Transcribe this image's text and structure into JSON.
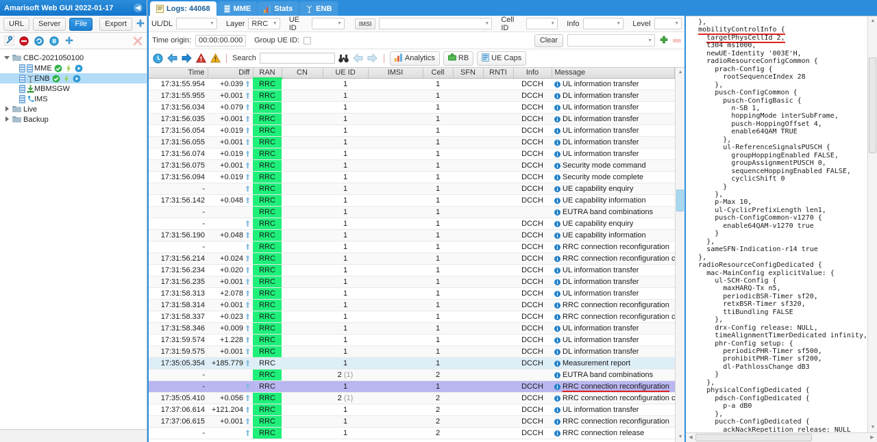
{
  "left": {
    "title": "Amarisoft Web GUI 2022-01-17",
    "collapse_icon": "chevron-left-icon",
    "source_buttons": [
      {
        "label": "URL",
        "active": false
      },
      {
        "label": "Server",
        "active": false
      },
      {
        "label": "File",
        "active": true
      }
    ],
    "export_label": "Export",
    "export_plus_icon": "blue-plus-icon",
    "tool_icons": [
      "wrench-icon",
      "stop-icon",
      "refresh-icon",
      "pause-icon",
      "blue-plus-icon"
    ],
    "delete_icon": "red-x-icon",
    "tree": [
      {
        "label": "CBC-2021050100",
        "level": 0,
        "type": "folder",
        "expanded": true,
        "selected": false,
        "badges": []
      },
      {
        "label": "MME",
        "level": 1,
        "type": "server",
        "selected": false,
        "badges": [
          "green-check-icon",
          "yellow-bolt-icon",
          "blue-play-icon"
        ]
      },
      {
        "label": "ENB",
        "level": 1,
        "type": "antenna",
        "selected": true,
        "badges": [
          "green-check-icon",
          "yellow-bolt-icon",
          "blue-play-icon"
        ]
      },
      {
        "label": "MBMSGW",
        "level": 1,
        "type": "download",
        "selected": false,
        "badges": []
      },
      {
        "label": "IMS",
        "level": 1,
        "type": "phone",
        "selected": false,
        "badges": []
      },
      {
        "label": "Live",
        "level": 0,
        "type": "folder",
        "expanded": false,
        "selected": false,
        "badges": []
      },
      {
        "label": "Backup",
        "level": 0,
        "type": "folder",
        "expanded": false,
        "selected": false,
        "badges": []
      }
    ]
  },
  "tabs": [
    {
      "label": "Logs: 44068",
      "icon": "document-icon",
      "active": true
    },
    {
      "label": "MME",
      "icon": "server-icon",
      "active": false
    },
    {
      "label": "Stats",
      "icon": "bar-chart-icon",
      "active": false
    },
    {
      "label": "ENB",
      "icon": "antenna-icon",
      "active": false
    }
  ],
  "filters": {
    "uldl": {
      "label": "UL/DL",
      "value": ""
    },
    "layer": {
      "label": "Layer",
      "value": "RRC"
    },
    "ueid": {
      "label": "UE ID",
      "value": ""
    },
    "imsi": {
      "label": "IMSI",
      "value": ""
    },
    "cellid": {
      "label": "Cell ID",
      "value": ""
    },
    "info": {
      "label": "Info",
      "value": ""
    },
    "level": {
      "label": "Level",
      "value": ""
    }
  },
  "origin": {
    "time_origin_label": "Time origin:",
    "time_origin_value": "00:00:00.000",
    "group_ue_id_label": "Group UE ID:",
    "group_ue_id_checked": false,
    "clear_label": "Clear",
    "preset_value": "",
    "add_icon": "green-plus-icon",
    "remove_icon": "red-minus-icon"
  },
  "actions": {
    "icons": [
      "clock-icon",
      "arrow-left-blue-icon",
      "arrow-right-blue-icon",
      "error-triangle-icon",
      "warning-triangle-icon"
    ],
    "search_label": "Search",
    "search_value": "",
    "search_placeholder": "",
    "binoculars_icon": "binoculars-icon",
    "prev_icon": "arrow-left-grey-icon",
    "next_icon": "arrow-right-grey-icon",
    "buttons": [
      {
        "label": "Analytics",
        "icon": "bar-chart-icon"
      },
      {
        "label": "RB",
        "icon": "green-box-icon"
      },
      {
        "label": "UE Caps",
        "icon": "blue-card-icon"
      }
    ]
  },
  "table": {
    "columns": [
      "Time",
      "Diff",
      "RAN",
      "CN",
      "UE ID",
      "IMSI",
      "Cell",
      "SFN",
      "RNTI",
      "Info",
      "Message"
    ],
    "rows": [
      {
        "time": "17:31:55.954",
        "diff": "+0.039",
        "arrow": true,
        "ran": "RRC",
        "cn": "",
        "ueid": "1",
        "imsi": "",
        "cell": "1",
        "sfn": "",
        "rnti": "",
        "info": "DCCH",
        "message": "UL information transfer",
        "state": ""
      },
      {
        "time": "17:31:55.955",
        "diff": "+0.001",
        "arrow": true,
        "ran": "RRC",
        "cn": "",
        "ueid": "1",
        "imsi": "",
        "cell": "1",
        "sfn": "",
        "rnti": "",
        "info": "DCCH",
        "message": "DL information transfer",
        "state": "alt"
      },
      {
        "time": "17:31:56.034",
        "diff": "+0.079",
        "arrow": true,
        "ran": "RRC",
        "cn": "",
        "ueid": "1",
        "imsi": "",
        "cell": "1",
        "sfn": "",
        "rnti": "",
        "info": "DCCH",
        "message": "UL information transfer",
        "state": ""
      },
      {
        "time": "17:31:56.035",
        "diff": "+0.001",
        "arrow": true,
        "ran": "RRC",
        "cn": "",
        "ueid": "1",
        "imsi": "",
        "cell": "1",
        "sfn": "",
        "rnti": "",
        "info": "DCCH",
        "message": "DL information transfer",
        "state": "alt"
      },
      {
        "time": "17:31:56.054",
        "diff": "+0.019",
        "arrow": true,
        "ran": "RRC",
        "cn": "",
        "ueid": "1",
        "imsi": "",
        "cell": "1",
        "sfn": "",
        "rnti": "",
        "info": "DCCH",
        "message": "UL information transfer",
        "state": ""
      },
      {
        "time": "17:31:56.055",
        "diff": "+0.001",
        "arrow": true,
        "ran": "RRC",
        "cn": "",
        "ueid": "1",
        "imsi": "",
        "cell": "1",
        "sfn": "",
        "rnti": "",
        "info": "DCCH",
        "message": "DL information transfer",
        "state": "alt"
      },
      {
        "time": "17:31:56.074",
        "diff": "+0.019",
        "arrow": true,
        "ran": "RRC",
        "cn": "",
        "ueid": "1",
        "imsi": "",
        "cell": "1",
        "sfn": "",
        "rnti": "",
        "info": "DCCH",
        "message": "UL information transfer",
        "state": ""
      },
      {
        "time": "17:31:56.075",
        "diff": "+0.001",
        "arrow": true,
        "ran": "RRC",
        "cn": "",
        "ueid": "1",
        "imsi": "",
        "cell": "1",
        "sfn": "",
        "rnti": "",
        "info": "DCCH",
        "message": "Security mode command",
        "state": "alt"
      },
      {
        "time": "17:31:56.094",
        "diff": "+0.019",
        "arrow": true,
        "ran": "RRC",
        "cn": "",
        "ueid": "1",
        "imsi": "",
        "cell": "1",
        "sfn": "",
        "rnti": "",
        "info": "DCCH",
        "message": "Security mode complete",
        "state": ""
      },
      {
        "time": "-",
        "diff": "",
        "arrow": true,
        "ran": "RRC",
        "cn": "",
        "ueid": "1",
        "imsi": "",
        "cell": "1",
        "sfn": "",
        "rnti": "",
        "info": "DCCH",
        "message": "UE capability enquiry",
        "state": "alt"
      },
      {
        "time": "17:31:56.142",
        "diff": "+0.048",
        "arrow": true,
        "ran": "RRC",
        "cn": "",
        "ueid": "1",
        "imsi": "",
        "cell": "1",
        "sfn": "",
        "rnti": "",
        "info": "DCCH",
        "message": "UE capability information",
        "state": ""
      },
      {
        "time": "-",
        "diff": "",
        "arrow": false,
        "ran": "RRC",
        "cn": "",
        "ueid": "1",
        "imsi": "",
        "cell": "1",
        "sfn": "",
        "rnti": "",
        "info": "",
        "message": "EUTRA band combinations",
        "state": "alt"
      },
      {
        "time": "-",
        "diff": "",
        "arrow": true,
        "ran": "RRC",
        "cn": "",
        "ueid": "1",
        "imsi": "",
        "cell": "1",
        "sfn": "",
        "rnti": "",
        "info": "DCCH",
        "message": "UE capability enquiry",
        "state": ""
      },
      {
        "time": "17:31:56.190",
        "diff": "+0.048",
        "arrow": true,
        "ran": "RRC",
        "cn": "",
        "ueid": "1",
        "imsi": "",
        "cell": "1",
        "sfn": "",
        "rnti": "",
        "info": "DCCH",
        "message": "UE capability information",
        "state": "alt"
      },
      {
        "time": "-",
        "diff": "",
        "arrow": true,
        "ran": "RRC",
        "cn": "",
        "ueid": "1",
        "imsi": "",
        "cell": "1",
        "sfn": "",
        "rnti": "",
        "info": "DCCH",
        "message": "RRC connection reconfiguration",
        "state": ""
      },
      {
        "time": "17:31:56.214",
        "diff": "+0.024",
        "arrow": true,
        "ran": "RRC",
        "cn": "",
        "ueid": "1",
        "imsi": "",
        "cell": "1",
        "sfn": "",
        "rnti": "",
        "info": "DCCH",
        "message": "RRC connection reconfiguration complete",
        "state": "alt"
      },
      {
        "time": "17:31:56.234",
        "diff": "+0.020",
        "arrow": true,
        "ran": "RRC",
        "cn": "",
        "ueid": "1",
        "imsi": "",
        "cell": "1",
        "sfn": "",
        "rnti": "",
        "info": "DCCH",
        "message": "UL information transfer",
        "state": ""
      },
      {
        "time": "17:31:56.235",
        "diff": "+0.001",
        "arrow": true,
        "ran": "RRC",
        "cn": "",
        "ueid": "1",
        "imsi": "",
        "cell": "1",
        "sfn": "",
        "rnti": "",
        "info": "DCCH",
        "message": "DL information transfer",
        "state": "alt"
      },
      {
        "time": "17:31:58.313",
        "diff": "+2.078",
        "arrow": true,
        "ran": "RRC",
        "cn": "",
        "ueid": "1",
        "imsi": "",
        "cell": "1",
        "sfn": "",
        "rnti": "",
        "info": "DCCH",
        "message": "UL information transfer",
        "state": ""
      },
      {
        "time": "17:31:58.314",
        "diff": "+0.001",
        "arrow": true,
        "ran": "RRC",
        "cn": "",
        "ueid": "1",
        "imsi": "",
        "cell": "1",
        "sfn": "",
        "rnti": "",
        "info": "DCCH",
        "message": "RRC connection reconfiguration",
        "state": "alt"
      },
      {
        "time": "17:31:58.337",
        "diff": "+0.023",
        "arrow": true,
        "ran": "RRC",
        "cn": "",
        "ueid": "1",
        "imsi": "",
        "cell": "1",
        "sfn": "",
        "rnti": "",
        "info": "DCCH",
        "message": "RRC connection reconfiguration complete",
        "state": ""
      },
      {
        "time": "17:31:58.346",
        "diff": "+0.009",
        "arrow": true,
        "ran": "RRC",
        "cn": "",
        "ueid": "1",
        "imsi": "",
        "cell": "1",
        "sfn": "",
        "rnti": "",
        "info": "DCCH",
        "message": "UL information transfer",
        "state": "alt"
      },
      {
        "time": "17:31:59.574",
        "diff": "+1.228",
        "arrow": true,
        "ran": "RRC",
        "cn": "",
        "ueid": "1",
        "imsi": "",
        "cell": "1",
        "sfn": "",
        "rnti": "",
        "info": "DCCH",
        "message": "UL information transfer",
        "state": ""
      },
      {
        "time": "17:31:59.575",
        "diff": "+0.001",
        "arrow": true,
        "ran": "RRC",
        "cn": "",
        "ueid": "1",
        "imsi": "",
        "cell": "1",
        "sfn": "",
        "rnti": "",
        "info": "DCCH",
        "message": "DL information transfer",
        "state": "alt"
      },
      {
        "time": "17:35:05.354",
        "diff": "+185.779",
        "arrow": true,
        "ran": "RRC",
        "cn": "",
        "ueid": "1",
        "imsi": "",
        "cell": "1",
        "sfn": "",
        "rnti": "",
        "info": "DCCH",
        "message": "Measurement report",
        "state": "sel-blue"
      },
      {
        "time": "-",
        "diff": "",
        "arrow": false,
        "ran": "RRC",
        "cn": "",
        "ueid": "2",
        "ueid_sub": "(1)",
        "imsi": "",
        "cell": "2",
        "sfn": "",
        "rnti": "",
        "info": "",
        "message": "EUTRA band combinations",
        "state": "alt"
      },
      {
        "time": "-",
        "diff": "",
        "arrow": true,
        "ran": "RRC",
        "cn": "",
        "ueid": "1",
        "imsi": "",
        "cell": "1",
        "sfn": "",
        "rnti": "",
        "info": "DCCH",
        "message": "RRC connection reconfiguration",
        "state": "sel-purple",
        "underlined": true
      },
      {
        "time": "17:35:05.410",
        "diff": "+0.056",
        "arrow": true,
        "ran": "RRC",
        "cn": "",
        "ueid": "2",
        "ueid_sub": "(1)",
        "imsi": "",
        "cell": "2",
        "sfn": "",
        "rnti": "",
        "info": "DCCH",
        "message": "RRC connection reconfiguration complete",
        "state": "alt"
      },
      {
        "time": "17:37:06.614",
        "diff": "+121.204",
        "arrow": true,
        "ran": "RRC",
        "cn": "",
        "ueid": "1",
        "imsi": "",
        "cell": "2",
        "sfn": "",
        "rnti": "",
        "info": "DCCH",
        "message": "UL information transfer",
        "state": ""
      },
      {
        "time": "17:37:06.615",
        "diff": "+0.001",
        "arrow": true,
        "ran": "RRC",
        "cn": "",
        "ueid": "1",
        "imsi": "",
        "cell": "2",
        "sfn": "",
        "rnti": "",
        "info": "DCCH",
        "message": "RRC connection reconfiguration",
        "state": "alt"
      },
      {
        "time": "-",
        "diff": "",
        "arrow": true,
        "ran": "RRC",
        "cn": "",
        "ueid": "1",
        "imsi": "",
        "cell": "2",
        "sfn": "",
        "rnti": "",
        "info": "DCCH",
        "message": "RRC connection release",
        "state": ""
      }
    ]
  },
  "detail": {
    "lines": [
      "  },",
      "  mobilityControlInfo {",
      "    targetPhysCellId 2,",
      "    t304 ms1000,",
      "    newUE-Identity '003E'H,",
      "    radioResourceConfigCommon {",
      "      prach-Config {",
      "        rootSequenceIndex 28",
      "      },",
      "      pusch-ConfigCommon {",
      "        pusch-ConfigBasic {",
      "          n-SB 1,",
      "          hoppingMode interSubFrame,",
      "          pusch-HoppingOffset 4,",
      "          enable64QAM TRUE",
      "        },",
      "        ul-ReferenceSignalsPUSCH {",
      "          groupHoppingEnabled FALSE,",
      "          groupAssignmentPUSCH 0,",
      "          sequenceHoppingEnabled FALSE,",
      "          cyclicShift 0",
      "        }",
      "      },",
      "      p-Max 10,",
      "      ul-CyclicPrefixLength len1,",
      "      pusch-ConfigCommon-v1270 {",
      "        enable64QAM-v1270 true",
      "      }",
      "    },",
      "    sameSFN-Indication-r14 true",
      "  },",
      "  radioResourceConfigDedicated {",
      "    mac-MainConfig explicitValue: {",
      "      ul-SCH-Config {",
      "        maxHARQ-Tx n5,",
      "        periodicBSR-Timer sf20,",
      "        retxBSR-Timer sf320,",
      "        ttiBundling FALSE",
      "      },",
      "      drx-Config release: NULL,",
      "      timeAlignmentTimerDedicated infinity,",
      "      phr-Config setup: {",
      "        periodicPHR-Timer sf500,",
      "        prohibitPHR-Timer sf200,",
      "        dl-PathlossChange dB3",
      "      }",
      "    },",
      "    physicalConfigDedicated {",
      "      pdsch-ConfigDedicated {",
      "        p-a dB0",
      "      },",
      "      pucch-ConfigDedicated {",
      "        ackNackRepetition release: NULL",
      "      },"
    ],
    "highlighted_lines": [
      1,
      2
    ]
  },
  "colors": {
    "brand_blue": "#2b8ddb",
    "ran_green": "#1ff07a",
    "selection_purple": "#b9b6f0",
    "selection_blue": "#ddeef7",
    "highlight_red": "#e02020"
  }
}
